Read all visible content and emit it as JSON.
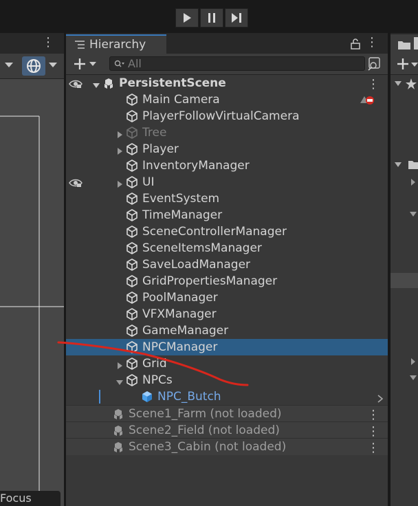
{
  "toolbar": {
    "play_icon": "play-icon",
    "pause_icon": "pause-icon",
    "step_icon": "step-icon"
  },
  "hierarchy": {
    "tab_title": "Hierarchy",
    "search_placeholder": "All",
    "rows": [
      {
        "label": "PersistentScene",
        "indent": 0,
        "type": "scene",
        "arrow": "down",
        "style": "bold",
        "eye": true
      },
      {
        "label": "Main Camera",
        "indent": 2,
        "type": "object",
        "warning": true
      },
      {
        "label": "PlayerFollowVirtualCamera",
        "indent": 2,
        "type": "object"
      },
      {
        "label": "Tree",
        "indent": 2,
        "type": "object",
        "arrow": "right",
        "style": "dim"
      },
      {
        "label": "Player",
        "indent": 2,
        "type": "object",
        "arrow": "right"
      },
      {
        "label": "InventoryManager",
        "indent": 2,
        "type": "object"
      },
      {
        "label": "UI",
        "indent": 2,
        "type": "object",
        "arrow": "right",
        "eye": true
      },
      {
        "label": "EventSystem",
        "indent": 2,
        "type": "object"
      },
      {
        "label": "TimeManager",
        "indent": 2,
        "type": "object"
      },
      {
        "label": "SceneControllerManager",
        "indent": 2,
        "type": "object"
      },
      {
        "label": "SceneItemsManager",
        "indent": 2,
        "type": "object"
      },
      {
        "label": "SaveLoadManager",
        "indent": 2,
        "type": "object"
      },
      {
        "label": "GridPropertiesManager",
        "indent": 2,
        "type": "object"
      },
      {
        "label": "PoolManager",
        "indent": 2,
        "type": "object"
      },
      {
        "label": "VFXManager",
        "indent": 2,
        "type": "object"
      },
      {
        "label": "GameManager",
        "indent": 2,
        "type": "object"
      },
      {
        "label": "NPCManager",
        "indent": 2,
        "type": "object",
        "selected": true
      },
      {
        "label": "Grid",
        "indent": 2,
        "type": "object",
        "arrow": "right"
      },
      {
        "label": "NPCs",
        "indent": 2,
        "type": "object",
        "arrow": "down"
      },
      {
        "label": "NPC_Butch",
        "indent": 3,
        "type": "prefab",
        "style": "blue",
        "chevron": true
      },
      {
        "label": "Scene1_Farm (not loaded)",
        "indent": 1,
        "type": "scene",
        "style": "gray",
        "kebab": true
      },
      {
        "label": "Scene2_Field (not loaded)",
        "indent": 1,
        "type": "scene",
        "style": "gray",
        "kebab": true
      },
      {
        "label": "Scene3_Cabin (not loaded)",
        "indent": 1,
        "type": "scene",
        "style": "gray",
        "kebab": true
      }
    ]
  },
  "scene_view": {
    "focus_label": "Focus"
  },
  "colors": {
    "selection": "#2c5d87",
    "accent": "#3a79bb",
    "annotation": "#d8261c"
  }
}
